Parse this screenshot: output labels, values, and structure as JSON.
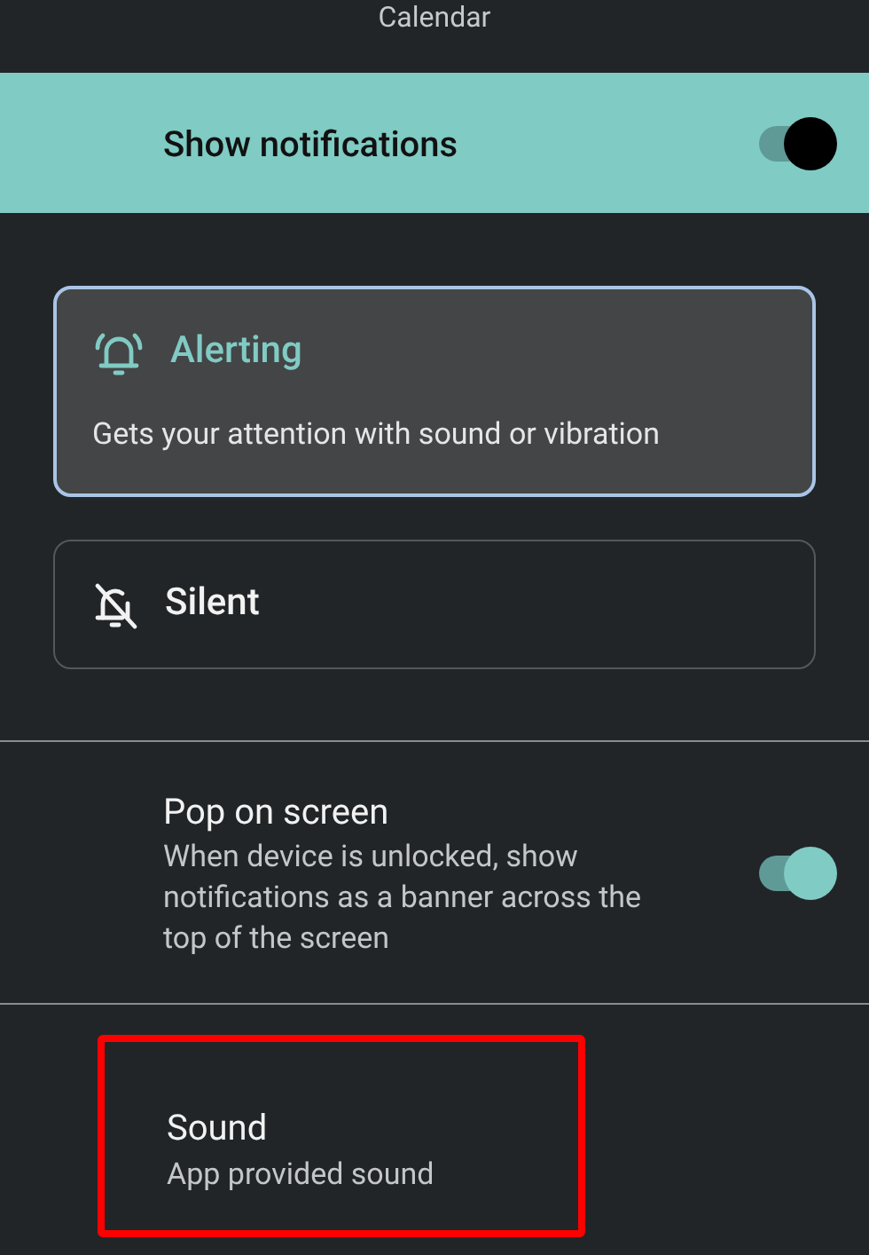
{
  "header": {
    "title": "Calendar"
  },
  "master_switch": {
    "label": "Show notifications",
    "on": true
  },
  "options": [
    {
      "kind": "alerting",
      "label": "Alerting",
      "description": "Gets your attention with sound or vibration",
      "selected": true
    },
    {
      "kind": "silent",
      "label": "Silent",
      "selected": false
    }
  ],
  "settings": [
    {
      "kind": "toggle",
      "title": "Pop on screen",
      "summary": "When device is unlocked, show notifications as a banner across the top of the screen",
      "on": true
    },
    {
      "kind": "link",
      "title": "Sound",
      "summary": "App provided sound",
      "highlighted": true
    }
  ]
}
